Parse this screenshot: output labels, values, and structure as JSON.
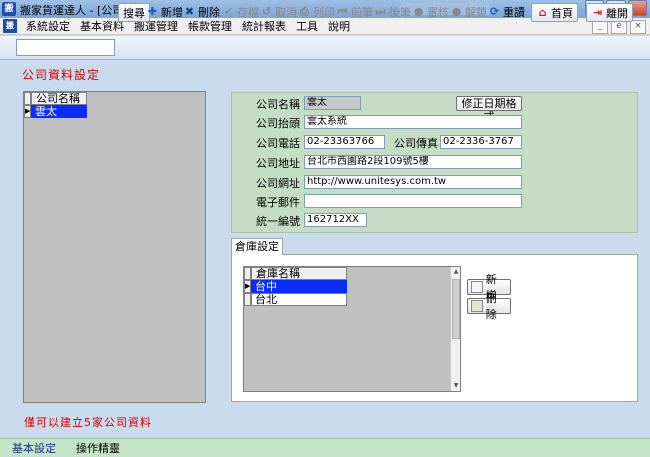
{
  "window": {
    "title": "搬家貨運達人 - [公司設定]",
    "icon_text": "搬"
  },
  "menu": [
    "系統設定",
    "基本資料",
    "搬運管理",
    "帳款管理",
    "統計報表",
    "工具",
    "說明"
  ],
  "mdi_controls": [
    "_",
    "e",
    "×"
  ],
  "toolbar": {
    "search_value": "",
    "search": "搜尋",
    "add": "新增",
    "delete": "刪除",
    "save": "存檔",
    "cancel": "取消",
    "print": "列印",
    "prev": "前筆",
    "next": "後筆",
    "review": "審核",
    "unlock": "解鎖",
    "refresh": "重讀",
    "home": "首頁",
    "exit": "離開"
  },
  "page": {
    "heading": "公司資料設定",
    "note": "僅可以建立5家公司資料"
  },
  "company_grid": {
    "column": "公司名稱",
    "rows": [
      "雲太"
    ]
  },
  "company_form": {
    "name_label": "公司名稱",
    "name": "雲太",
    "date_format_button": "修正日期格式",
    "header_label": "公司抬頭",
    "header": "雲太系統",
    "phone_label": "公司電話",
    "phone": "02-23363766",
    "fax_label": "公司傳真",
    "fax": "02-2336-3767",
    "address_label": "公司地址",
    "address": "台北市西園路2段109號5樓",
    "website_label": "公司網址",
    "website": "http://www.unitesys.com.tw",
    "email_label": "電子郵件",
    "email": "",
    "tax_id_label": "統一編號",
    "tax_id": "162712XX"
  },
  "warehouse": {
    "tab": "倉庫設定",
    "column": "倉庫名稱",
    "rows": [
      "台中",
      "台北"
    ],
    "add_button": "新增",
    "delete_button": "刪除"
  },
  "statusbar": [
    "基本設定",
    "操作精靈"
  ],
  "colors": {
    "accent_red": "#d60000",
    "selection_blue": "#0a2cff",
    "form_green": "#c4ddc4"
  }
}
